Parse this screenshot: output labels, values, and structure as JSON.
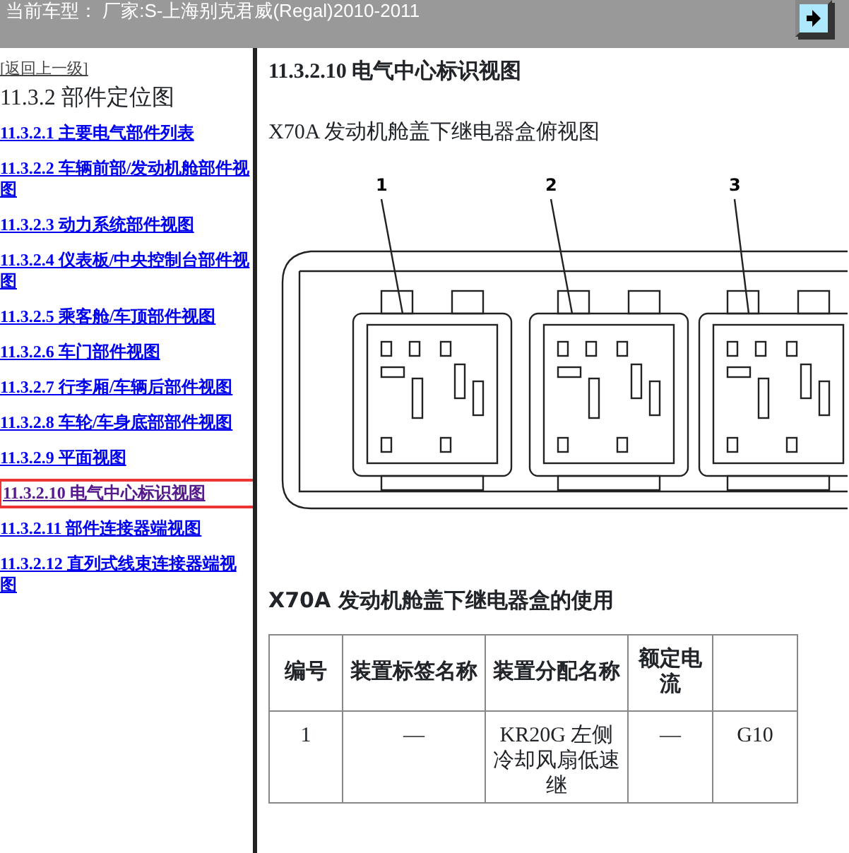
{
  "header": {
    "vehicle": "当前车型： 厂家:S-上海别克君威(Regal)2010-2011"
  },
  "sidebar": {
    "back_link": "[返回上一级]",
    "title": "11.3.2 部件定位图",
    "items": [
      {
        "number": "11.3.2.1",
        "label": "主要电气部件列表",
        "selected": false
      },
      {
        "number": "11.3.2.2",
        "label": "车辆前部/发动机舱部件视图",
        "selected": false
      },
      {
        "number": "11.3.2.3",
        "label": "动力系统部件视图",
        "selected": false
      },
      {
        "number": "11.3.2.4",
        "label": "仪表板/中央控制台部件视图",
        "selected": false
      },
      {
        "number": "11.3.2.5",
        "label": "乘客舱/车顶部件视图",
        "selected": false
      },
      {
        "number": "11.3.2.6",
        "label": "车门部件视图",
        "selected": false
      },
      {
        "number": "11.3.2.7",
        "label": "行李厢/车辆后部件视图",
        "selected": false
      },
      {
        "number": "11.3.2.8",
        "label": "车轮/车身底部部件视图",
        "selected": false
      },
      {
        "number": "11.3.2.9",
        "label": "平面视图",
        "selected": false
      },
      {
        "number": "11.3.2.10",
        "label": "电气中心标识视图",
        "selected": true
      },
      {
        "number": "11.3.2.11",
        "label": "部件连接器端视图",
        "selected": false
      },
      {
        "number": "11.3.2.12",
        "label": "直列式线束连接器端视图",
        "selected": false
      }
    ]
  },
  "content": {
    "title": "11.3.2.10 电气中心标识视图",
    "subtitle": "X70A 发动机舱盖下继电器盒俯视图",
    "diagram_callouts": [
      "1",
      "2",
      "3"
    ],
    "table_title": "X70A 发动机舱盖下继电器盒的使用",
    "table": {
      "columns": [
        "编号",
        "装置标签名称",
        "装置分配名称",
        "额定电流",
        ""
      ],
      "rows": [
        [
          "1",
          "—",
          "KR20G 左侧冷却风扇低速继",
          "—",
          "G10"
        ]
      ]
    }
  }
}
